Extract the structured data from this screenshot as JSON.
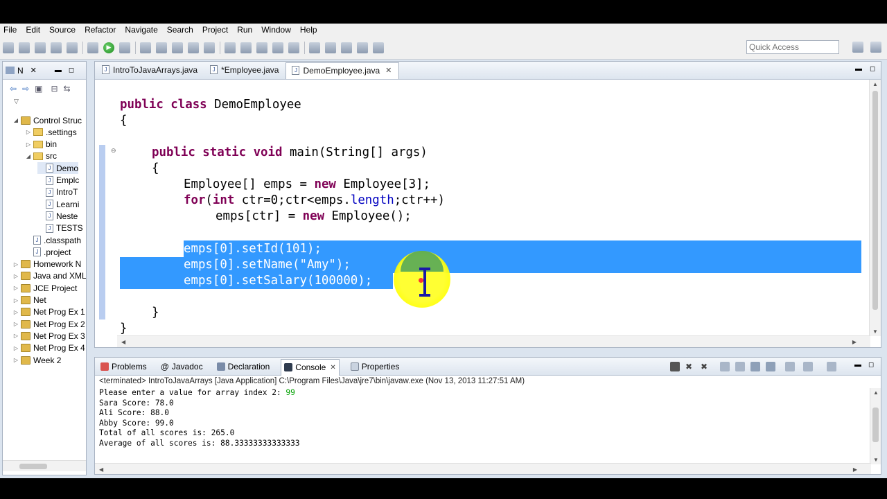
{
  "menu": [
    "File",
    "Edit",
    "Source",
    "Refactor",
    "Navigate",
    "Search",
    "Project",
    "Run",
    "Window",
    "Help"
  ],
  "toolbar": {
    "quick_access_placeholder": "Quick Access"
  },
  "explorer": {
    "tab_label": "N",
    "items": [
      {
        "label": "Control Struc",
        "type": "project",
        "twisty": "◢",
        "indent": 0
      },
      {
        "label": ".settings",
        "type": "folder",
        "twisty": "▷",
        "indent": 1
      },
      {
        "label": "bin",
        "type": "folder",
        "twisty": "▷",
        "indent": 1
      },
      {
        "label": "src",
        "type": "folder",
        "twisty": "◢",
        "indent": 1
      },
      {
        "label": "Demo",
        "type": "file",
        "twisty": "",
        "indent": 2,
        "selected": true
      },
      {
        "label": "Emplc",
        "type": "file",
        "twisty": "",
        "indent": 2
      },
      {
        "label": "IntroT",
        "type": "file",
        "twisty": "",
        "indent": 2
      },
      {
        "label": "Learni",
        "type": "file",
        "twisty": "",
        "indent": 2
      },
      {
        "label": "Neste",
        "type": "file",
        "twisty": "",
        "indent": 2
      },
      {
        "label": "TESTS",
        "type": "file",
        "twisty": "",
        "indent": 2
      },
      {
        "label": ".classpath",
        "type": "file",
        "twisty": "",
        "indent": 1
      },
      {
        "label": ".project",
        "type": "file",
        "twisty": "",
        "indent": 1
      },
      {
        "label": "Homework N",
        "type": "project",
        "twisty": "▷",
        "indent": 0
      },
      {
        "label": "Java and XML",
        "type": "project",
        "twisty": "▷",
        "indent": 0
      },
      {
        "label": "JCE Project",
        "type": "project",
        "twisty": "▷",
        "indent": 0
      },
      {
        "label": "Net",
        "type": "project",
        "twisty": "▷",
        "indent": 0
      },
      {
        "label": "Net Prog Ex 1",
        "type": "project",
        "twisty": "▷",
        "indent": 0
      },
      {
        "label": "Net Prog Ex 2",
        "type": "project",
        "twisty": "▷",
        "indent": 0
      },
      {
        "label": "Net Prog Ex 3",
        "type": "project",
        "twisty": "▷",
        "indent": 0
      },
      {
        "label": "Net Prog Ex 4",
        "type": "project",
        "twisty": "▷",
        "indent": 0
      },
      {
        "label": "Week 2",
        "type": "project",
        "twisty": "▷",
        "indent": 0
      }
    ]
  },
  "editor": {
    "tabs": [
      {
        "label": "IntroToJavaArrays.java",
        "active": false
      },
      {
        "label": "*Employee.java",
        "active": false
      },
      {
        "label": "DemoEmployee.java",
        "active": true
      }
    ]
  },
  "code": {
    "l1_kw": "public class ",
    "l1_rest": "DemoEmployee",
    "l2": "{",
    "l3_kw": "public static void ",
    "l3_rest": "main(String[] args)",
    "l4": "{",
    "l5_a": "Employee[] emps = ",
    "l5_kw": "new",
    "l5_b": " Employee[3];",
    "l6_kw1": "for",
    "l6_a": "(",
    "l6_kw2": "int",
    "l6_b": " ctr=0;ctr<emps.",
    "l6_fld": "length",
    "l6_c": ";ctr++)",
    "l7_a": "emps[ctr] = ",
    "l7_kw": "new",
    "l7_b": " Employee();",
    "l8": "emps[0].setId(101);",
    "l9_a": "emps[0].setName(",
    "l9_str": "\"Amy\"",
    "l9_b": ");",
    "l10": "emps[0].setSalary(100000);",
    "l11": "}",
    "l12": "}"
  },
  "console": {
    "tabs": [
      "Problems",
      "Javadoc",
      "Declaration",
      "Console",
      "Properties"
    ],
    "status": "<terminated> IntroToJavaArrays [Java Application] C:\\Program Files\\Java\\jre7\\bin\\javaw.exe (Nov 13, 2013 11:27:51 AM)",
    "prompt": "Please enter a value for array index 2: ",
    "user_input": "99",
    "lines": [
      "Sara Score: 78.0",
      "Ali Score: 88.0",
      "Abby Score: 99.0",
      "Total of all scores is: 265.0",
      "Average of all scores is: 88.33333333333333"
    ]
  },
  "colors": {
    "selection": "#3399ff",
    "keyword": "#7f0055",
    "field": "#0000c0",
    "string": "#2a00ff",
    "cursor_halo": "#ffff33"
  }
}
